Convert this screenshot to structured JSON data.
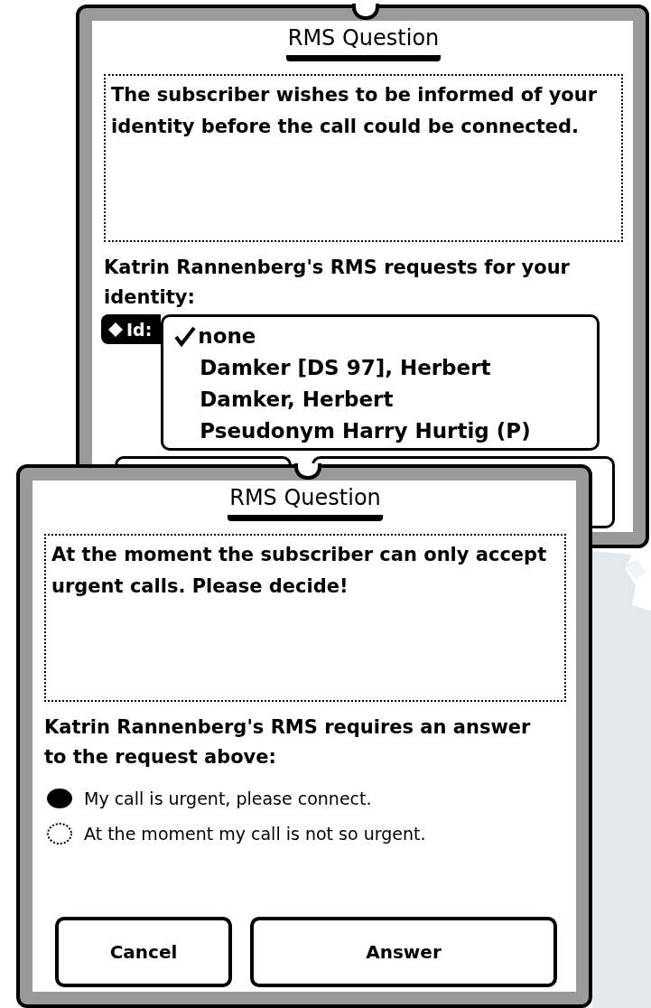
{
  "dialogs": [
    {
      "kind": "identity",
      "title": "RMS Question",
      "message": "The subscriber wishes to be informed of your identity before the call could be connected.",
      "prompt": "Katrin Rannenberg's RMS requests for your identity:",
      "id_label": "Id:",
      "options": [
        {
          "label": "none",
          "selected": true
        },
        {
          "label": "Damker [DS 97], Herbert",
          "selected": false
        },
        {
          "label": "Damker, Herbert",
          "selected": false
        },
        {
          "label": "Pseudonym Harry Hurtig (P)",
          "selected": false
        }
      ]
    },
    {
      "kind": "choice",
      "title": "RMS Question",
      "message": "At the moment the subscriber can only accept urgent calls. Please decide!",
      "prompt": "Katrin Rannenberg's RMS requires an answer to the request above:",
      "choices": [
        {
          "label": "My call is urgent, please connect.",
          "selected": true
        },
        {
          "label": "At the moment my call is not so urgent.",
          "selected": false
        }
      ],
      "buttons": [
        "Cancel",
        "Answer"
      ]
    }
  ]
}
